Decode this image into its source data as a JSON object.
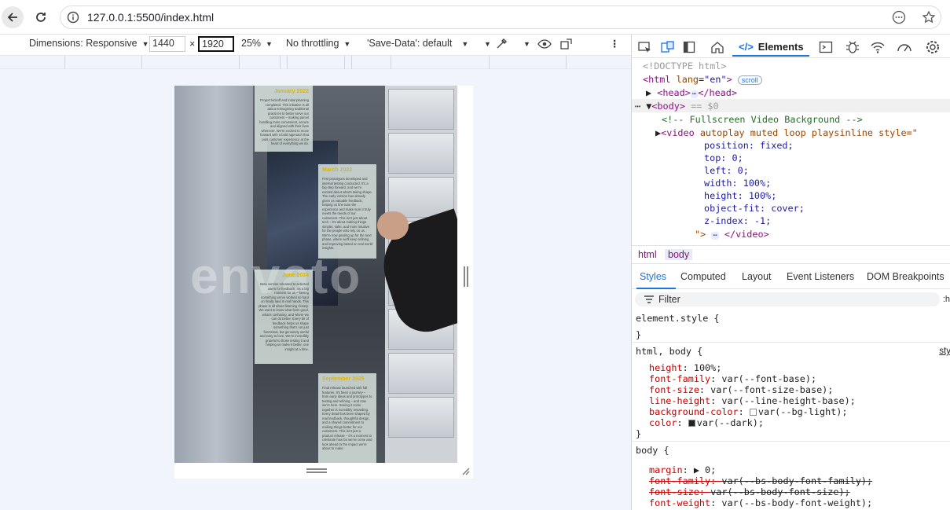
{
  "browser": {
    "url": "127.0.0.1:5500/index.html"
  },
  "emulation": {
    "dimensions_label": "Dimensions: Responsive",
    "width": "1440",
    "times": "×",
    "height": "1920",
    "zoom": "25%",
    "throttling": "No throttling",
    "save_data": "'Save-Data': default"
  },
  "page": {
    "watermark": "envato",
    "cards": [
      {
        "title": "January 2022",
        "body": "Project kickoff and initial planning completed. This initiative is all about reimagining traditional practices to better serve our customers – making parcel handling more convenient, secure and aligned with their lives wherever. We're excited to move forward with a bold approach that puts customer experience at the heart of everything we do."
      },
      {
        "title": "March 2022",
        "body": "First prototypes developed and internal testing conducted. It's a big step forward, and we're excited about what's taking shape. The early version has already given us valuable feedback, helping us fine tune the experience and make sure it truly meets the needs of our customers. This isn't just about tech – it's about making things simpler, safer, and more intuitive for the people who rely on us. We're now gearing up for the next phase, where we'll keep refining and improving based on real world insights."
      },
      {
        "title": "June 2024",
        "body": "Beta version released to selected users for feedback. It's a big moment for us – seeing something we've worked so hard on finally land in real hands. This phase is all about listening closely. We want to know what feels good, what's confusing, and where we can do better. Every bit of feedback helps us shape something that's not just functional, but genuinely useful and easy to love. We're incredibly grateful to those testing it and helping us make it better, one insight at a time."
      },
      {
        "title": "September 2025",
        "body": "Final release launched with full features. It's been a journey – from early ideas and prototypes to testing and refining – and now we're here. Seeing it come together is incredibly rewarding. Every detail has been shaped by real feedback, thoughtful design, and a shared commitment to making things better for our customers. This isn't just a product release – it's a moment to celebrate how far we've come and look ahead to the impact we're about to make."
      }
    ]
  },
  "devtools": {
    "active_tab": "Elements",
    "dom_lines": {
      "doctype": "<!DOCTYPE html>",
      "html_open": "<html ",
      "html_attr": "lang",
      "html_val": "\"en\"",
      "scroll_pill": "scroll",
      "head": "<head>",
      "head_close": "</head>",
      "body": "<body>",
      "body_eq": "== $0",
      "comment": "<!-- Fullscreen Video Background -->",
      "video_open": "<video ",
      "video_attrs": "autoplay muted loop playsinline style=\"",
      "style_lines": [
        "position: fixed;",
        "top: 0;",
        "left: 0;",
        "width: 100%;",
        "height: 100%;",
        "object-fit: cover;",
        "z-index: -1;"
      ],
      "video_end_q": "\">",
      "video_close": "</video>",
      "ellipsis": "⋯"
    },
    "breadcrumbs": [
      "html",
      "body"
    ],
    "subtabs": [
      "Styles",
      "Computed",
      "Layout",
      "Event Listeners",
      "DOM Breakpoints"
    ],
    "filter_placeholder": "Filter",
    "filter_extra": ":h",
    "rules": {
      "element_style": "element.style {",
      "close": "}",
      "html_body": "html, body {",
      "html_body_src": "sty",
      "html_body_props": [
        {
          "name": "height",
          "value": "100%;"
        },
        {
          "name": "font-family",
          "value": "var(--font-base);"
        },
        {
          "name": "font-size",
          "value": "var(--font-size-base);"
        },
        {
          "name": "line-height",
          "value": "var(--line-height-base);"
        },
        {
          "name": "background-color",
          "value": "var(--bg-light);"
        },
        {
          "name": "color",
          "value": "var(--dark);"
        }
      ],
      "body_sel": "body {",
      "margin_name": "margin",
      "margin_val": "▶ 0;",
      "struck": [
        {
          "name": "font-family",
          "value": "var(--bs-body-font-family);"
        },
        {
          "name": "font-size",
          "value": "var(--bs-body-font-size);"
        }
      ],
      "font_weight_name": "font-weight",
      "font_weight_val": "var(--bs-body-font-weight);"
    },
    "colors": {
      "accent": "#1a73e8",
      "tag": "#881280",
      "prop": "#c80000",
      "comment": "#236e25"
    }
  }
}
